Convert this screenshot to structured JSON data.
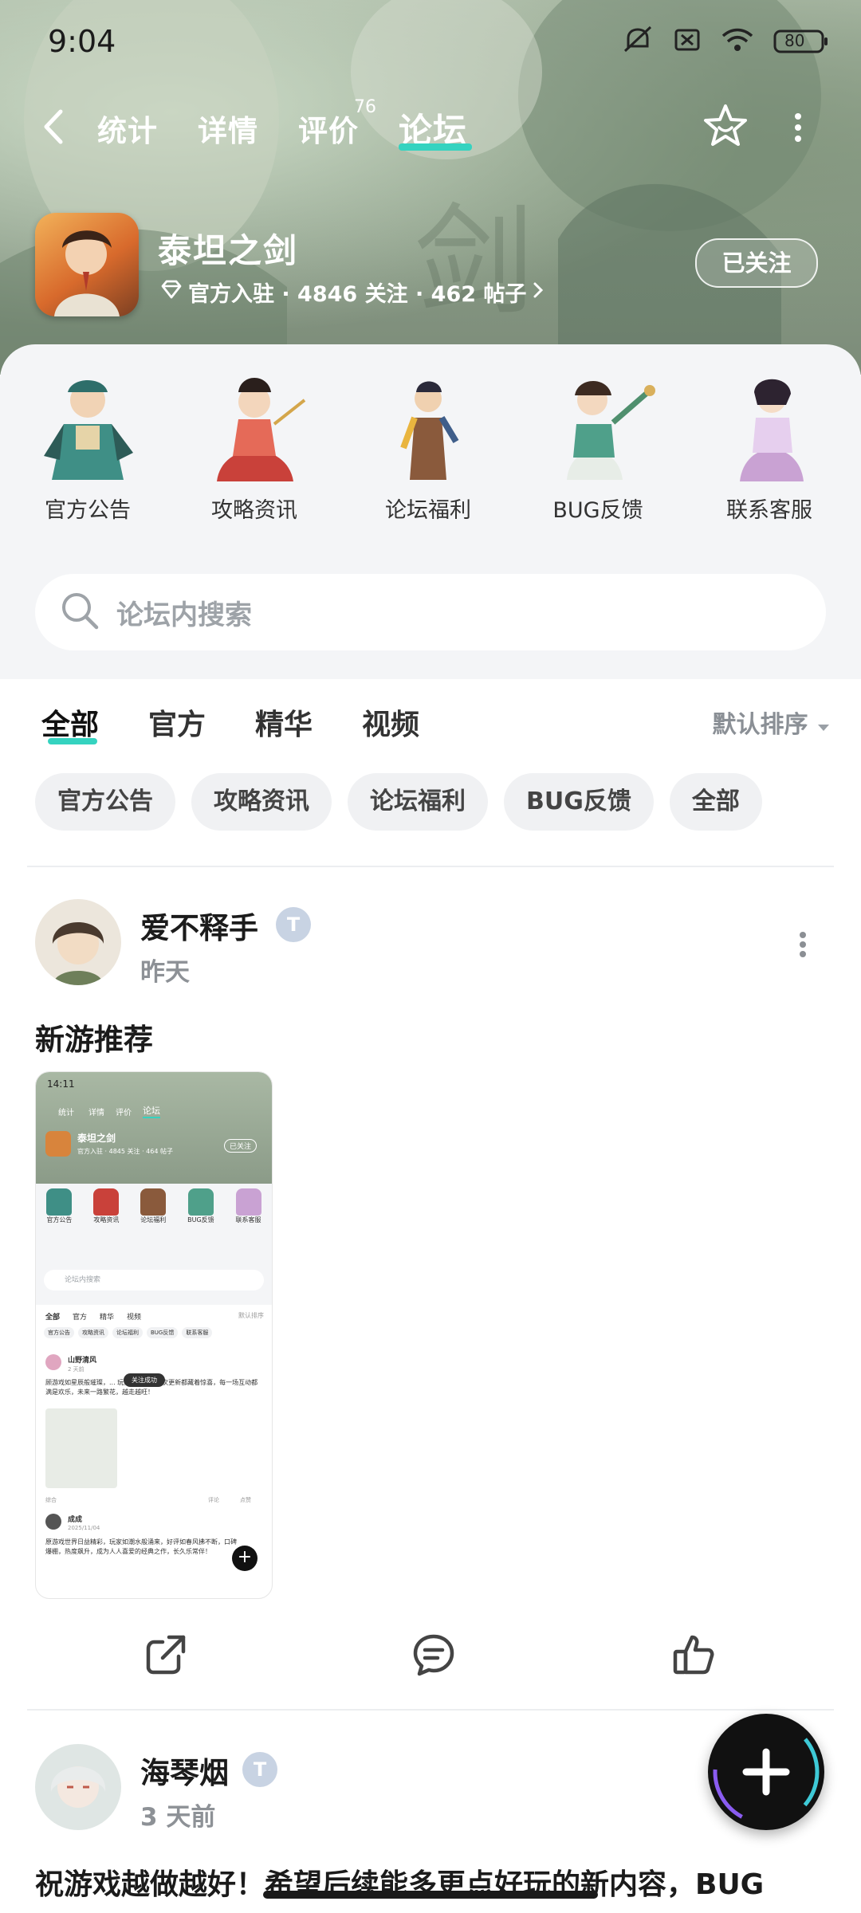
{
  "status_bar": {
    "time": "9:04",
    "battery": "80"
  },
  "nav": {
    "tabs": [
      {
        "label": "统计"
      },
      {
        "label": "详情"
      },
      {
        "label": "评价",
        "badge": "76"
      },
      {
        "label": "论坛",
        "active": true
      }
    ]
  },
  "game": {
    "name": "泰坦之剑",
    "meta": "官方入驻 · 4846 关注 · 462 帖子",
    "follow_label": "已关注"
  },
  "categories": [
    {
      "label": "官方公告"
    },
    {
      "label": "攻略资讯"
    },
    {
      "label": "论坛福利"
    },
    {
      "label": "BUG反馈"
    },
    {
      "label": "联系客服"
    }
  ],
  "search": {
    "placeholder": "论坛内搜索"
  },
  "filter_tabs": [
    {
      "label": "全部",
      "active": true
    },
    {
      "label": "官方"
    },
    {
      "label": "精华"
    },
    {
      "label": "视频"
    }
  ],
  "sort_label": "默认排序",
  "chips": [
    "官方公告",
    "攻略资讯",
    "论坛福利",
    "BUG反馈",
    "全部"
  ],
  "posts": [
    {
      "author": "爱不释手",
      "time": "昨天",
      "title": "新游推荐",
      "thumb": {
        "time": "14:11",
        "tabs": [
          "统计",
          "详情",
          "评价",
          "论坛"
        ],
        "game_name": "泰坦之剑",
        "game_meta": "官方入驻 · 4845 关注 · 464 帖子",
        "follow": "已关注",
        "categories": [
          "官方公告",
          "攻略资讯",
          "论坛福利",
          "BUG反馈",
          "联系客服"
        ],
        "search": "论坛内搜索",
        "filters": [
          "全部",
          "官方",
          "精华",
          "视频"
        ],
        "sort": "默认排序",
        "chips": [
          "官方公告",
          "攻略资讯",
          "论坛福利",
          "BUG反馈",
          "联系客服"
        ],
        "p1_author": "山野清风",
        "p1_time": "2 天前",
        "p1_text": "顾游戏如星辰般璀璨，... 玩家聚聚。每一次更新都藏着惊喜，每一场互动都满是欢乐，未来一路繁花，越走越旺！",
        "toast": "关注成功",
        "p1_footer_left": "综合",
        "p1_comment": "评论",
        "p1_like": "点赞",
        "p2_author": "成成",
        "p2_time": "2025/11/04",
        "p2_text": "原游戏世界日益精彩，玩家如潮水般涌来，好评如春风拂不断，口碑爆棚，热度飙升，成为人人喜爱的经典之作，长久乐常伴！"
      }
    },
    {
      "author": "海琴烟",
      "time": "3 天前",
      "text": "祝游戏越做越好！希望后续能多更点好玩的新内容，BUG"
    }
  ]
}
